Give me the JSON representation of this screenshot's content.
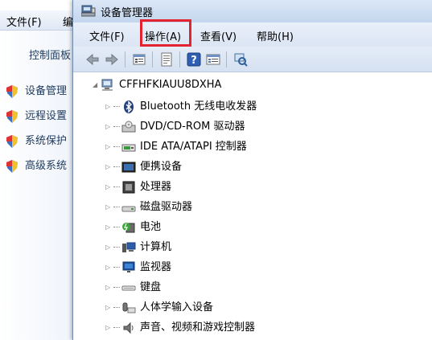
{
  "background_window": {
    "menu": {
      "file": "文件(F)",
      "edit_partial": "编"
    },
    "home_link": "控制面板",
    "tasks": [
      "设备管理",
      "远程设置",
      "系统保护",
      "高级系统"
    ]
  },
  "device_manager": {
    "title": "设备管理器",
    "menu": [
      {
        "label": "文件(F)"
      },
      {
        "label": "操作(A)"
      },
      {
        "label": "查看(V)"
      },
      {
        "label": "帮助(H)"
      }
    ],
    "toolbar": [
      "back-icon",
      "forward-icon",
      "properties-icon",
      "help-doc-icon",
      "help-icon",
      "view-icon",
      "scan-icon"
    ],
    "root": "CFFHFKIAUU8DXHA",
    "devices": [
      {
        "label": "Bluetooth 无线电收发器",
        "icon": "bluetooth-icon"
      },
      {
        "label": "DVD/CD-ROM 驱动器",
        "icon": "dvd-icon"
      },
      {
        "label": "IDE ATA/ATAPI 控制器",
        "icon": "ide-icon"
      },
      {
        "label": "便携设备",
        "icon": "portable-device-icon"
      },
      {
        "label": "处理器",
        "icon": "processor-icon"
      },
      {
        "label": "磁盘驱动器",
        "icon": "disk-icon"
      },
      {
        "label": "电池",
        "icon": "battery-icon"
      },
      {
        "label": "计算机",
        "icon": "computer-icon"
      },
      {
        "label": "监视器",
        "icon": "monitor-icon"
      },
      {
        "label": "键盘",
        "icon": "keyboard-icon"
      },
      {
        "label": "人体学输入设备",
        "icon": "hid-icon"
      },
      {
        "label": "声音、视频和游戏控制器",
        "icon": "sound-icon"
      }
    ]
  },
  "colors": {
    "highlight": "#e3232f",
    "link": "#1e395b",
    "titlebar": "#c3d6ee"
  }
}
